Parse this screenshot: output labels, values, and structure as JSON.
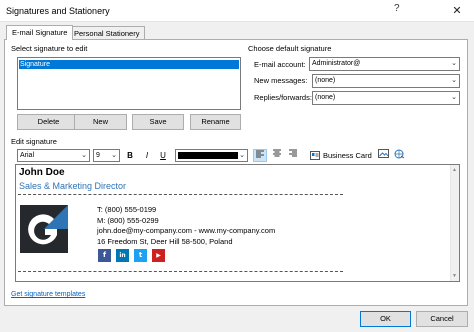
{
  "window": {
    "title": "Signatures and Stationery",
    "help_label": "?",
    "close_label": "✕"
  },
  "tabs": [
    {
      "label": "E-mail Signature",
      "active": true
    },
    {
      "label": "Personal Stationery",
      "active": false
    }
  ],
  "select_signature": {
    "label": "Select signature to edit",
    "items": [
      "Signature"
    ]
  },
  "buttons": {
    "delete": "Delete",
    "new": "New",
    "save": "Save",
    "rename": "Rename"
  },
  "default_signature": {
    "heading": "Choose default signature",
    "email_account_label": "E-mail account:",
    "email_account_value": "Administrator@",
    "new_messages_label": "New messages:",
    "new_messages_value": "(none)",
    "replies_label": "Replies/forwards:",
    "replies_value": "(none)"
  },
  "edit_signature": {
    "label": "Edit signature",
    "font": "Arial",
    "size": "9",
    "bold": "B",
    "italic": "I",
    "underline": "U",
    "font_color": "#000000",
    "business_card": "Business Card"
  },
  "signature": {
    "name": "John Doe",
    "title": "Sales & Marketing Director",
    "phone1": "T: (800) 555-0199",
    "phone2": "M: (800) 555-0299",
    "contact": "john.doe@my-company.com - www.my-company.com",
    "address": "16 Freedom St, Deer Hill 58-500, Poland",
    "name_color": "#000000",
    "title_color": "#2e75b6",
    "social": [
      {
        "name": "facebook",
        "glyph": "f",
        "color": "#3b5998"
      },
      {
        "name": "linkedin",
        "glyph": "in",
        "color": "#0077b5"
      },
      {
        "name": "twitter",
        "glyph": "t",
        "color": "#1da1f2"
      },
      {
        "name": "youtube",
        "glyph": "▶",
        "color": "#cd201f"
      }
    ]
  },
  "footer": {
    "templates_link": "Get signature templates",
    "ok": "OK",
    "cancel": "Cancel"
  }
}
